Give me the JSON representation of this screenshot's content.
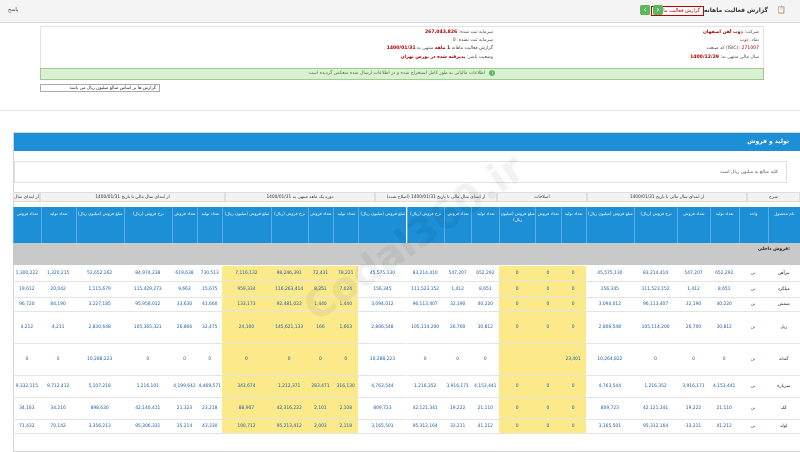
{
  "topbar": {
    "title": "گزارش فعالیت ماهانه",
    "report_tag": "گزارش فعالیت ماهانه",
    "left_label": "پاسخ",
    "report_link": "گزارش‌ها"
  },
  "info": {
    "company_label": "شرکت:",
    "company": "ذوب آهن اصفهان",
    "symbol_label": "نماد:",
    "symbol": "ذوب",
    "code_label": "کد صنعت (ISIC):",
    "code": "271007",
    "year_label": "سال مالی منتهی به:",
    "year": "1400/12/29",
    "capital_label": "سرمایه ثبت شده:",
    "capital": "267,043,826",
    "capital_unreg_label": "سرمایه ثبت نشده:",
    "capital_unreg": "0",
    "report_label": "گزارش فعالیت ماهانه",
    "month_label": "1 ماهه",
    "period_label": "منتهی به",
    "period": "1400/01/31",
    "status_label": "وضعیت ناشر:",
    "status": "پذیرفته شده در بورس تهران"
  },
  "notice": "اطلاعات مالیاتی به طور کامل استخراج شده و در اطلاعات ارسال شده منعکس گردیده است",
  "select_value": "گزارش ها بر اساس مبالغ میلیون ریال می باشد",
  "panel_title": "تولید و فروش",
  "panel_note": "کلیه مبالغ به میلیون ریال است",
  "group_header": {
    "a": "اطلاعات به ازای دوره یک ماهه منتهی به 1400/01/31",
    "b": "از ابتدای سال مالی تا تاریخ 1400/01/31",
    "c": "اصلاحات",
    "d": "از ابتدای سال مالی تا تاریخ 1400/01/31 (اصلاح شده)",
    "e": "دوره یک ماهه منتهی به 1400/01/31",
    "f": "از ابتدای سال مالی تا تاریخ 1400/01/31",
    "g": "شرح",
    "h": "از ابتدای سال"
  },
  "columns": [
    "نام محصول",
    "واحد",
    "تعداد تولید",
    "تعداد فروش",
    "نرخ فروش (ریال)",
    "مبلغ فروش (میلیون ریال)",
    "تعداد تولید",
    "تعداد فروش",
    "مبلغ فروش (میلیون ریال)",
    "تعداد تولید",
    "تعداد فروش",
    "نرخ فروش (ریال)",
    "مبلغ فروش (میلیون ریال)",
    "تعداد تولید",
    "تعداد فروش",
    "نرخ فروش (ریال)",
    "مبلغ فروش (میلیون ریال)",
    "تعداد تولید",
    "تعداد فروش",
    "نرخ فروش (ریال)",
    "مبلغ فروش (میلیون ریال)",
    "تعداد تولید",
    "تعداد فروش"
  ],
  "group_label": "فروش داخلی:",
  "rows": [
    [
      "تیرآهن",
      "تن",
      "652,292",
      "547,207",
      "83,214,410",
      "45,575,130",
      "0",
      "0",
      "0",
      "652,292",
      "547,207",
      "83,214,410",
      "45,575,130",
      "78,221",
      "72,431",
      "98,246,391",
      "7,116,132",
      "730,513",
      "619,638",
      "84,974,238",
      "52,652,262",
      "1,320,215",
      "1,300,222"
    ],
    [
      "میلگرد",
      "تن",
      "8,651",
      "1,412",
      "111,523,152",
      "156,345",
      "0",
      "0",
      "0",
      "8,651",
      "1,412",
      "111,523,152",
      "156,345",
      "7,024",
      "8,251",
      "116,263,414",
      "959,334",
      "15,675",
      "9,663",
      "115,429,273",
      "1,115,679",
      "20,042",
      "19,612"
    ],
    [
      "شمش",
      "تن",
      "40,220",
      "32,190",
      "96,113,407",
      "3,094,012",
      "0",
      "0",
      "0",
      "40,220",
      "32,190",
      "96,113,407",
      "3,094,012",
      "1,440",
      "1,440",
      "92,481,022",
      "133,173",
      "41,660",
      "33,630",
      "95,958,012",
      "3,227,185",
      "84,190",
      "96,720"
    ],
    [
      "ریل",
      "تن",
      "30,812",
      "26,700",
      "105,114,200",
      "2,806,548",
      "0",
      "0",
      "0",
      "30,812",
      "26,700",
      "105,114,200",
      "2,806,548",
      "1,663",
      "166",
      "145,621,133",
      "24,100",
      "32,475",
      "26,866",
      "105,365,321",
      "2,830,648",
      "4,211",
      "4,212"
    ],
    [
      "گندله",
      "تن",
      "0",
      "0",
      "0",
      "10,264,822",
      "23,401",
      "",
      "",
      "0",
      "0",
      "0",
      "10,288,223",
      "0",
      "0",
      "0",
      "0",
      "0",
      "0",
      "0",
      "10,288,223",
      "0",
      "0"
    ],
    [
      "سرباره",
      "تن",
      "4,153,441",
      "3,916,171",
      "1,216,352",
      "4,763,544",
      "0",
      "0",
      "0",
      "4,153,441",
      "3,916,171",
      "1,216,352",
      "4,763,544",
      "316,130",
      "283,471",
      "1,212,371",
      "343,674",
      "4,469,571",
      "4,199,642",
      "1,216,101",
      "5,107,218",
      "9,712,412",
      "9,332,115"
    ],
    [
      "کک",
      "تن",
      "21,110",
      "19,222",
      "42,121,341",
      "809,723",
      "0",
      "0",
      "0",
      "21,110",
      "19,222",
      "42,121,341",
      "809,723",
      "2,108",
      "2,101",
      "42,316,222",
      "88,907",
      "23,218",
      "21,323",
      "42,140,411",
      "898,630",
      "34,216",
      "34,163"
    ],
    [
      "لوله",
      "تن",
      "41,212",
      "33,211",
      "95,312,164",
      "3,165,501",
      "0",
      "0",
      "0",
      "41,212",
      "33,211",
      "95,312,164",
      "3,165,501",
      "2,118",
      "2,003",
      "95,213,412",
      "190,712",
      "43,330",
      "35,214",
      "95,306,331",
      "3,356,213",
      "70,142",
      "71,432"
    ]
  ],
  "row_sample_first": "تیرآهن"
}
